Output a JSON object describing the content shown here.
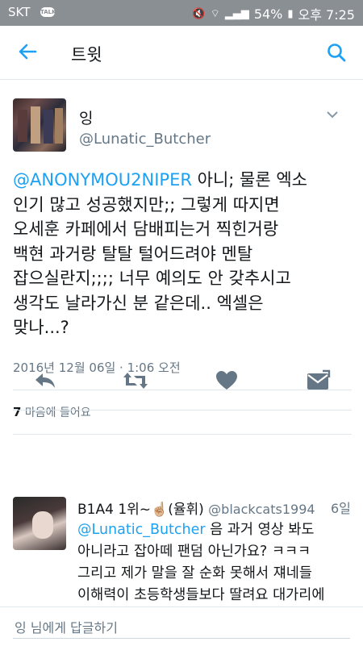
{
  "status_bar": {
    "carrier": "SKT",
    "talk_badge": "TALK",
    "battery": "54%",
    "time": "오후 7:25"
  },
  "app_bar": {
    "title": "트윗",
    "back_icon": "arrow-left-icon",
    "search_icon": "search-icon",
    "accent": "#1da1f2"
  },
  "tweet": {
    "name": "잉",
    "handle": "@Lunatic_Butcher",
    "mention": "@ANONYMOU2NIPER",
    "line1_rest": " 아니; 물론 엑소",
    "line2": "인기 많고 성공했지만;; 그렇게 따지면",
    "line3": "오세훈 카페에서 담배피는거 찍힌거랑",
    "line4": "백현 과거랑 탈탈 털어드려야 멘탈",
    "line5": "잡으실란지;;;; 너무 예의도 안 갖추시고",
    "line6": "생각도 날라가신 분 같은데.. 엑셀은",
    "line7": "맞나...?",
    "timestamp": "2016년 12월 06일 · 1:06 오전",
    "likes_count": "7",
    "likes_label": "마음에 들어요"
  },
  "actions": {
    "reply_icon": "reply-icon",
    "retweet_icon": "retweet-icon",
    "like_icon": "heart-icon",
    "dm_icon": "message-icon"
  },
  "reply": {
    "name": "B1A4 1위~☝🏼(율휘)",
    "handle": "@blackcats1994",
    "time": "6일",
    "mention": "@Lunatic_Butcher",
    "line1_rest": " 음 과거 영상 봐도",
    "line2": "아니라고 잡아떼 팬덤 아닌가요? ㅋㅋㅋ",
    "line3": "그리고 제가 말을 잘 순화 못해서 쟤네들",
    "line4": "이해력이 초등학생들보다 딸려요 대가리에"
  },
  "reply_bar": {
    "placeholder": "잉 님에게 답글하기"
  }
}
